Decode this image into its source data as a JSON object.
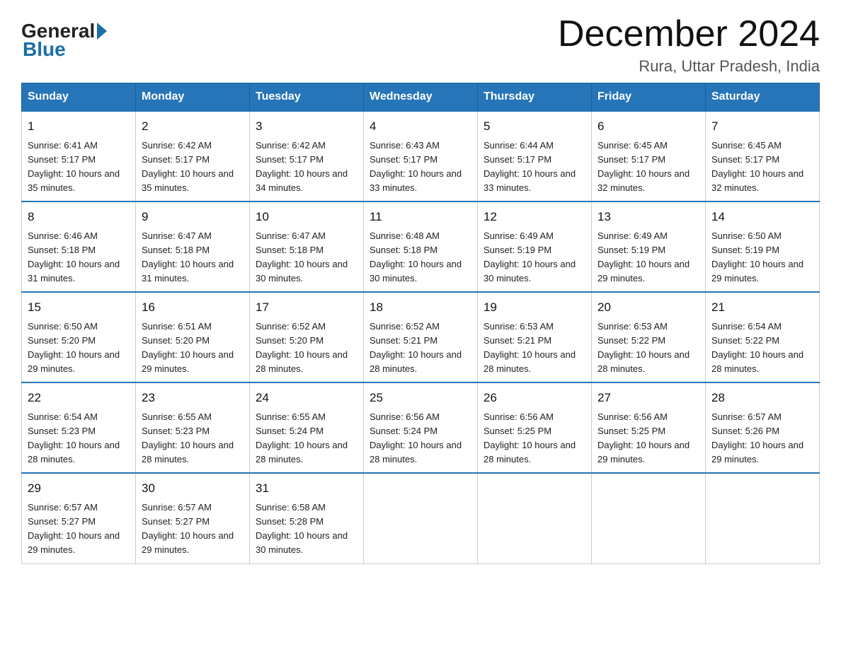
{
  "header": {
    "logo_general": "General",
    "logo_blue": "Blue",
    "month_title": "December 2024",
    "location": "Rura, Uttar Pradesh, India"
  },
  "days_of_week": [
    "Sunday",
    "Monday",
    "Tuesday",
    "Wednesday",
    "Thursday",
    "Friday",
    "Saturday"
  ],
  "weeks": [
    [
      {
        "day": "1",
        "sunrise": "6:41 AM",
        "sunset": "5:17 PM",
        "daylight": "10 hours and 35 minutes."
      },
      {
        "day": "2",
        "sunrise": "6:42 AM",
        "sunset": "5:17 PM",
        "daylight": "10 hours and 35 minutes."
      },
      {
        "day": "3",
        "sunrise": "6:42 AM",
        "sunset": "5:17 PM",
        "daylight": "10 hours and 34 minutes."
      },
      {
        "day": "4",
        "sunrise": "6:43 AM",
        "sunset": "5:17 PM",
        "daylight": "10 hours and 33 minutes."
      },
      {
        "day": "5",
        "sunrise": "6:44 AM",
        "sunset": "5:17 PM",
        "daylight": "10 hours and 33 minutes."
      },
      {
        "day": "6",
        "sunrise": "6:45 AM",
        "sunset": "5:17 PM",
        "daylight": "10 hours and 32 minutes."
      },
      {
        "day": "7",
        "sunrise": "6:45 AM",
        "sunset": "5:17 PM",
        "daylight": "10 hours and 32 minutes."
      }
    ],
    [
      {
        "day": "8",
        "sunrise": "6:46 AM",
        "sunset": "5:18 PM",
        "daylight": "10 hours and 31 minutes."
      },
      {
        "day": "9",
        "sunrise": "6:47 AM",
        "sunset": "5:18 PM",
        "daylight": "10 hours and 31 minutes."
      },
      {
        "day": "10",
        "sunrise": "6:47 AM",
        "sunset": "5:18 PM",
        "daylight": "10 hours and 30 minutes."
      },
      {
        "day": "11",
        "sunrise": "6:48 AM",
        "sunset": "5:18 PM",
        "daylight": "10 hours and 30 minutes."
      },
      {
        "day": "12",
        "sunrise": "6:49 AM",
        "sunset": "5:19 PM",
        "daylight": "10 hours and 30 minutes."
      },
      {
        "day": "13",
        "sunrise": "6:49 AM",
        "sunset": "5:19 PM",
        "daylight": "10 hours and 29 minutes."
      },
      {
        "day": "14",
        "sunrise": "6:50 AM",
        "sunset": "5:19 PM",
        "daylight": "10 hours and 29 minutes."
      }
    ],
    [
      {
        "day": "15",
        "sunrise": "6:50 AM",
        "sunset": "5:20 PM",
        "daylight": "10 hours and 29 minutes."
      },
      {
        "day": "16",
        "sunrise": "6:51 AM",
        "sunset": "5:20 PM",
        "daylight": "10 hours and 29 minutes."
      },
      {
        "day": "17",
        "sunrise": "6:52 AM",
        "sunset": "5:20 PM",
        "daylight": "10 hours and 28 minutes."
      },
      {
        "day": "18",
        "sunrise": "6:52 AM",
        "sunset": "5:21 PM",
        "daylight": "10 hours and 28 minutes."
      },
      {
        "day": "19",
        "sunrise": "6:53 AM",
        "sunset": "5:21 PM",
        "daylight": "10 hours and 28 minutes."
      },
      {
        "day": "20",
        "sunrise": "6:53 AM",
        "sunset": "5:22 PM",
        "daylight": "10 hours and 28 minutes."
      },
      {
        "day": "21",
        "sunrise": "6:54 AM",
        "sunset": "5:22 PM",
        "daylight": "10 hours and 28 minutes."
      }
    ],
    [
      {
        "day": "22",
        "sunrise": "6:54 AM",
        "sunset": "5:23 PM",
        "daylight": "10 hours and 28 minutes."
      },
      {
        "day": "23",
        "sunrise": "6:55 AM",
        "sunset": "5:23 PM",
        "daylight": "10 hours and 28 minutes."
      },
      {
        "day": "24",
        "sunrise": "6:55 AM",
        "sunset": "5:24 PM",
        "daylight": "10 hours and 28 minutes."
      },
      {
        "day": "25",
        "sunrise": "6:56 AM",
        "sunset": "5:24 PM",
        "daylight": "10 hours and 28 minutes."
      },
      {
        "day": "26",
        "sunrise": "6:56 AM",
        "sunset": "5:25 PM",
        "daylight": "10 hours and 28 minutes."
      },
      {
        "day": "27",
        "sunrise": "6:56 AM",
        "sunset": "5:25 PM",
        "daylight": "10 hours and 29 minutes."
      },
      {
        "day": "28",
        "sunrise": "6:57 AM",
        "sunset": "5:26 PM",
        "daylight": "10 hours and 29 minutes."
      }
    ],
    [
      {
        "day": "29",
        "sunrise": "6:57 AM",
        "sunset": "5:27 PM",
        "daylight": "10 hours and 29 minutes."
      },
      {
        "day": "30",
        "sunrise": "6:57 AM",
        "sunset": "5:27 PM",
        "daylight": "10 hours and 29 minutes."
      },
      {
        "day": "31",
        "sunrise": "6:58 AM",
        "sunset": "5:28 PM",
        "daylight": "10 hours and 30 minutes."
      },
      null,
      null,
      null,
      null
    ]
  ]
}
